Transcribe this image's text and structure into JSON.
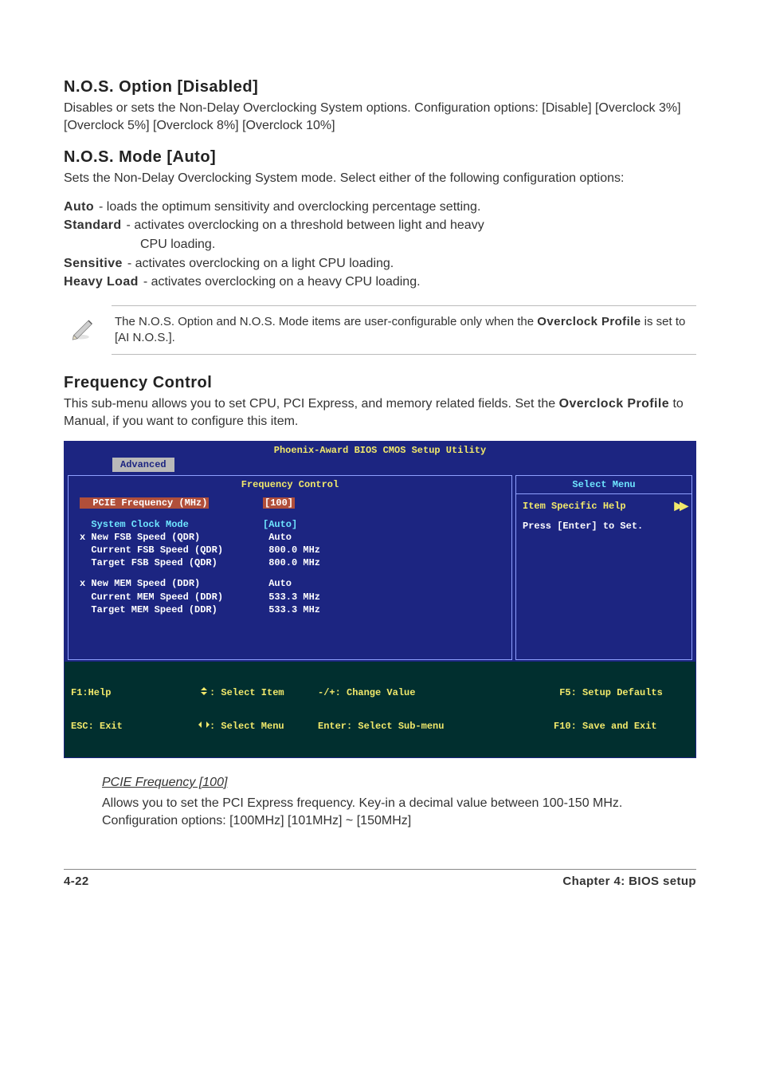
{
  "section1": {
    "title": "N.O.S. Option [Disabled]",
    "body": "Disables or sets the Non-Delay Overclocking System options. Configuration options: [Disable] [Overclock 3%] [Overclock 5%] [Overclock 8%] [Overclock 10%]"
  },
  "section2": {
    "title": "N.O.S. Mode [Auto]",
    "body": "Sets the Non-Delay Overclocking System mode. Select either of the following configuration options:",
    "options": [
      {
        "label": "Auto",
        "desc": " - loads the optimum sensitivity and overclocking percentage setting."
      },
      {
        "label": "Standard",
        "desc": " - activates overclocking on a threshold between light and heavy",
        "cont": "CPU loading."
      },
      {
        "label": "Sensitive",
        "desc": " - activates overclocking on a light CPU loading."
      },
      {
        "label": "Heavy Load",
        "desc": " - activates overclocking on a heavy CPU loading."
      }
    ]
  },
  "note": {
    "pre": "The N.O.S. Option and N.O.S. Mode items are user-configurable only when the ",
    "bold": "Overclock Profile",
    "post": " is set to [AI N.O.S.]."
  },
  "section3": {
    "title": "Frequency Control",
    "body_pre": "This sub-menu allows you to set CPU, PCI Express, and memory related fields. Set the ",
    "body_bold": "Overclock Profile",
    "body_post": " to Manual, if you want to configure this item."
  },
  "bios": {
    "titlebar": "Phoenix-Award BIOS CMOS Setup Utility",
    "tab": "Advanced",
    "left_title": "Frequency Control",
    "rows": [
      {
        "c1": "  PCIE Frequency (MHz)",
        "c2": "[100]",
        "c1cls": "hl",
        "c2cls": "hl"
      },
      {
        "spacer": true
      },
      {
        "c1": "  System Clock Mode",
        "c2": "[Auto]",
        "c1cls": "cyan",
        "c2cls": "cyan"
      },
      {
        "c1": "x New FSB Speed (QDR)",
        "c2": " Auto",
        "c1cls": "white",
        "c2cls": "white"
      },
      {
        "c1": "  Current FSB Speed (QDR)",
        "c2": " 800.0 MHz",
        "c1cls": "white",
        "c2cls": "white"
      },
      {
        "c1": "  Target FSB Speed (QDR)",
        "c2": " 800.0 MHz",
        "c1cls": "white",
        "c2cls": "white"
      },
      {
        "spacer": true
      },
      {
        "c1": "x New MEM Speed (DDR)",
        "c2": " Auto",
        "c1cls": "white",
        "c2cls": "white"
      },
      {
        "c1": "  Current MEM Speed (DDR)",
        "c2": " 533.3 MHz",
        "c1cls": "white",
        "c2cls": "white"
      },
      {
        "c1": "  Target MEM Speed (DDR)",
        "c2": " 533.3 MHz",
        "c1cls": "white",
        "c2cls": "white"
      }
    ],
    "right_title": "Select Menu",
    "right_line1": "Item Specific Help",
    "right_line2": "Press [Enter] to Set.",
    "footer": {
      "r1c1": "F1:Help",
      "r1c2": ": Select Item",
      "r1c3": "-/+: Change Value",
      "r1c4": " F5: Setup Defaults",
      "r2c1": "ESC: Exit",
      "r2c2": ": Select Menu",
      "r2c3": "Enter: Select Sub-menu",
      "r2c4": "F10: Save and Exit"
    }
  },
  "sub": {
    "title": "PCIE Frequency [100]",
    "text": "Allows you to set the PCI Express frequency. Key-in a decimal value between 100-150 MHz. Configuration options: [100MHz] [101MHz] ~ [150MHz]"
  },
  "footer": {
    "left": "4-22",
    "right": "Chapter 4: BIOS setup"
  },
  "chart_data": {
    "type": "table",
    "title": "Frequency Control",
    "rows": [
      {
        "field": "PCIE Frequency (MHz)",
        "value": "100",
        "editable": true,
        "selected": true
      },
      {
        "field": "System Clock Mode",
        "value": "Auto",
        "editable": true
      },
      {
        "field": "New FSB Speed (QDR)",
        "value": "Auto",
        "editable": false
      },
      {
        "field": "Current FSB Speed (QDR)",
        "value": "800.0 MHz",
        "editable": false
      },
      {
        "field": "Target FSB Speed (QDR)",
        "value": "800.0 MHz",
        "editable": false
      },
      {
        "field": "New MEM Speed (DDR)",
        "value": "Auto",
        "editable": false
      },
      {
        "field": "Current MEM Speed (DDR)",
        "value": "533.3 MHz",
        "editable": false
      },
      {
        "field": "Target MEM Speed (DDR)",
        "value": "533.3 MHz",
        "editable": false
      }
    ]
  }
}
